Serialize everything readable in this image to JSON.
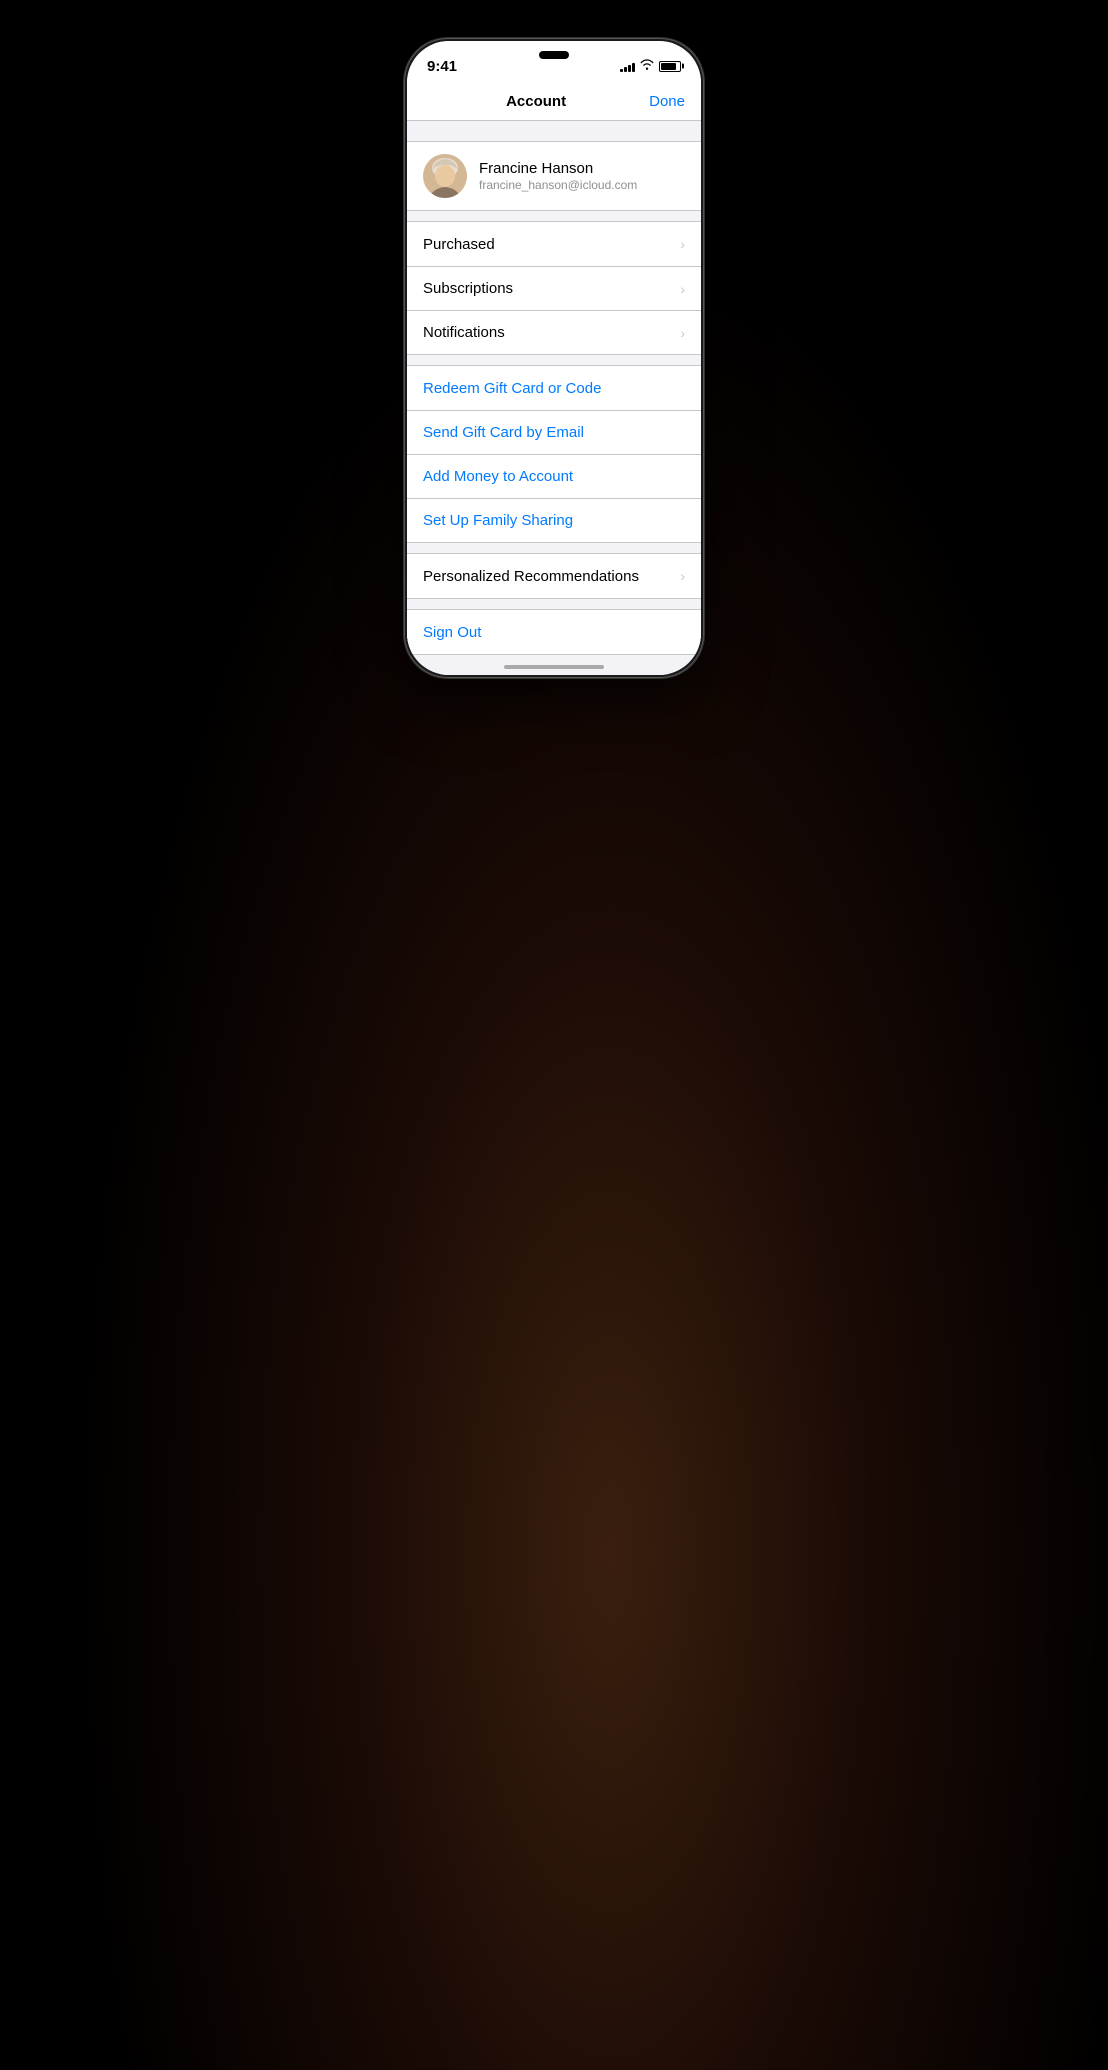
{
  "page": {
    "background": "#000000"
  },
  "statusBar": {
    "time": "9:41",
    "signalBars": [
      3,
      5,
      7,
      9,
      11
    ],
    "batteryLevel": 85
  },
  "header": {
    "title": "Account",
    "doneLabel": "Done"
  },
  "profile": {
    "name": "Francine Hanson",
    "email": "francine_hanson@icloud.com"
  },
  "sections": {
    "main": [
      {
        "label": "Purchased",
        "hasChevron": true
      },
      {
        "label": "Subscriptions",
        "hasChevron": true
      },
      {
        "label": "Notifications",
        "hasChevron": true
      }
    ],
    "giftCard": [
      {
        "label": "Redeem Gift Card or Code",
        "hasChevron": false,
        "blue": true
      },
      {
        "label": "Send Gift Card by Email",
        "hasChevron": false,
        "blue": true
      },
      {
        "label": "Add Money to Account",
        "hasChevron": false,
        "blue": true
      },
      {
        "label": "Set Up Family Sharing",
        "hasChevron": false,
        "blue": true
      }
    ],
    "recommendations": [
      {
        "label": "Personalized Recommendations",
        "hasChevron": true
      }
    ],
    "signout": [
      {
        "label": "Sign Out",
        "hasChevron": false,
        "blue": true
      }
    ]
  }
}
